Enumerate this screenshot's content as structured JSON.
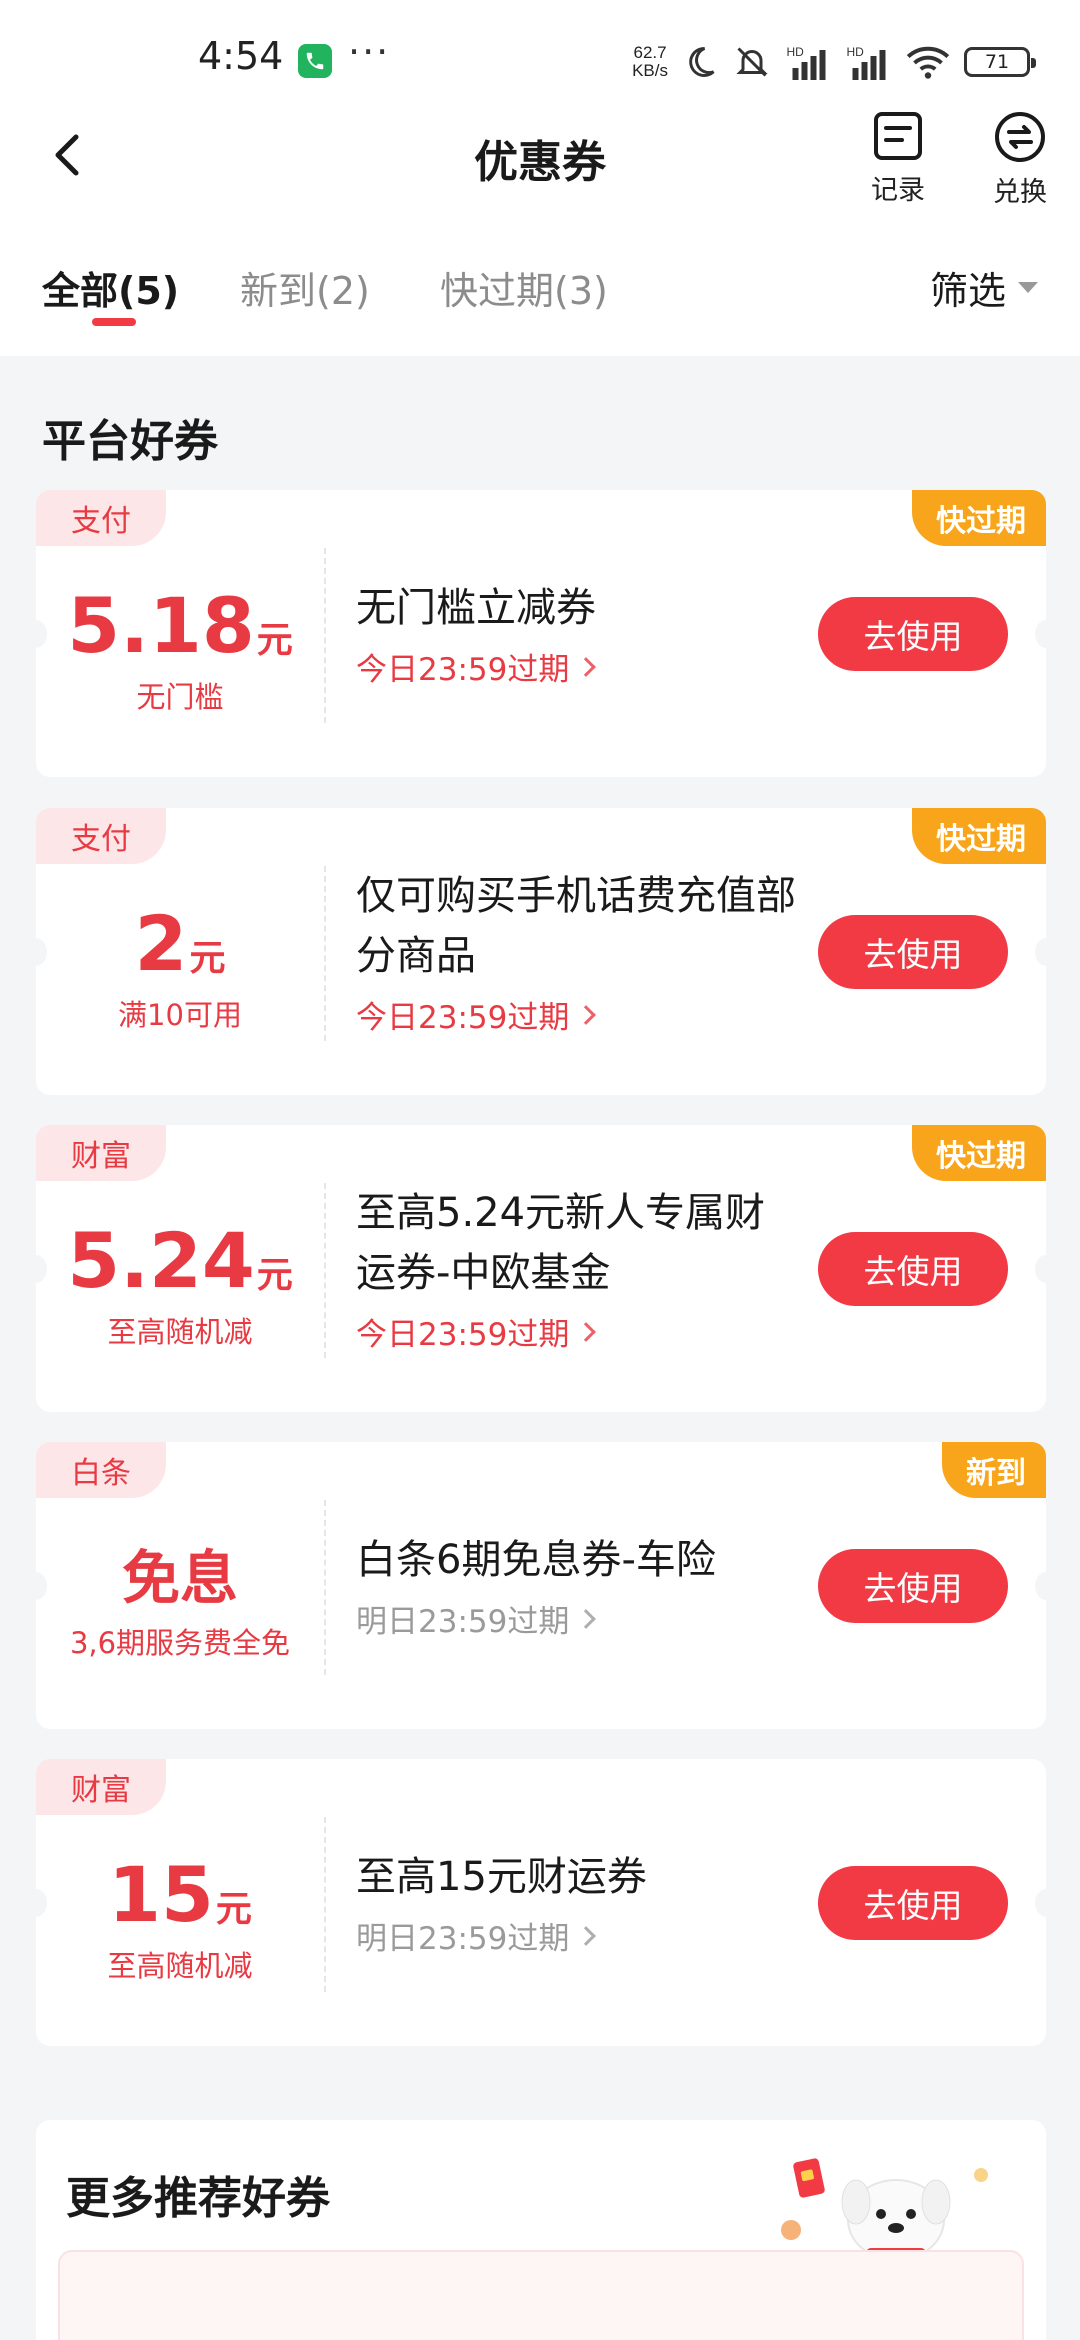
{
  "status_bar": {
    "time": "4:54",
    "speed_value": "62.7",
    "speed_unit": "KB/s",
    "battery": "71",
    "icons": [
      "call-icon",
      "more-dots-icon",
      "moon-icon",
      "mute-icon",
      "signal-icon",
      "wifi-icon",
      "battery-icon"
    ]
  },
  "header": {
    "title": "优惠券",
    "record_label": "记录",
    "exchange_label": "兑换"
  },
  "tabs": [
    {
      "label": "全部(5)",
      "active": true
    },
    {
      "label": "新到(2)",
      "active": false
    },
    {
      "label": "快过期(3)",
      "active": false
    }
  ],
  "filter_label": "筛选",
  "section_title": "平台好券",
  "coupons": [
    {
      "category": "支付",
      "status": "快过期",
      "amount": "5.18",
      "unit": "元",
      "condition": "无门槛",
      "title": "无门槛立减券",
      "expiry": "今日23:59过期",
      "button": "去使用"
    },
    {
      "category": "支付",
      "status": "快过期",
      "amount": "2",
      "unit": "元",
      "condition": "满10可用",
      "title": "仅可购买手机话费充值部分商品",
      "expiry": "今日23:59过期",
      "button": "去使用"
    },
    {
      "category": "财富",
      "status": "快过期",
      "amount": "5.24",
      "unit": "元",
      "condition": "至高随机减",
      "title": "至高5.24元新人专属财运券-中欧基金",
      "expiry": "今日23:59过期",
      "button": "去使用"
    },
    {
      "category": "白条",
      "status": "新到",
      "amount": "免息",
      "unit": "",
      "condition": "3,6期服务费全免",
      "title": "白条6期免息券-车险",
      "expiry": "明日23:59过期",
      "button": "去使用"
    },
    {
      "category": "财富",
      "status": "",
      "amount": "15",
      "unit": "元",
      "condition": "至高随机减",
      "title": "至高15元财运券",
      "expiry": "明日23:59过期",
      "button": "去使用"
    }
  ],
  "recommend_title": "更多推荐好券",
  "colors": {
    "accent_red": "#f23a45",
    "tag_orange": "#f8a51b",
    "tag_bg": "#fde6e7",
    "page_bg": "#f4f5f7"
  }
}
